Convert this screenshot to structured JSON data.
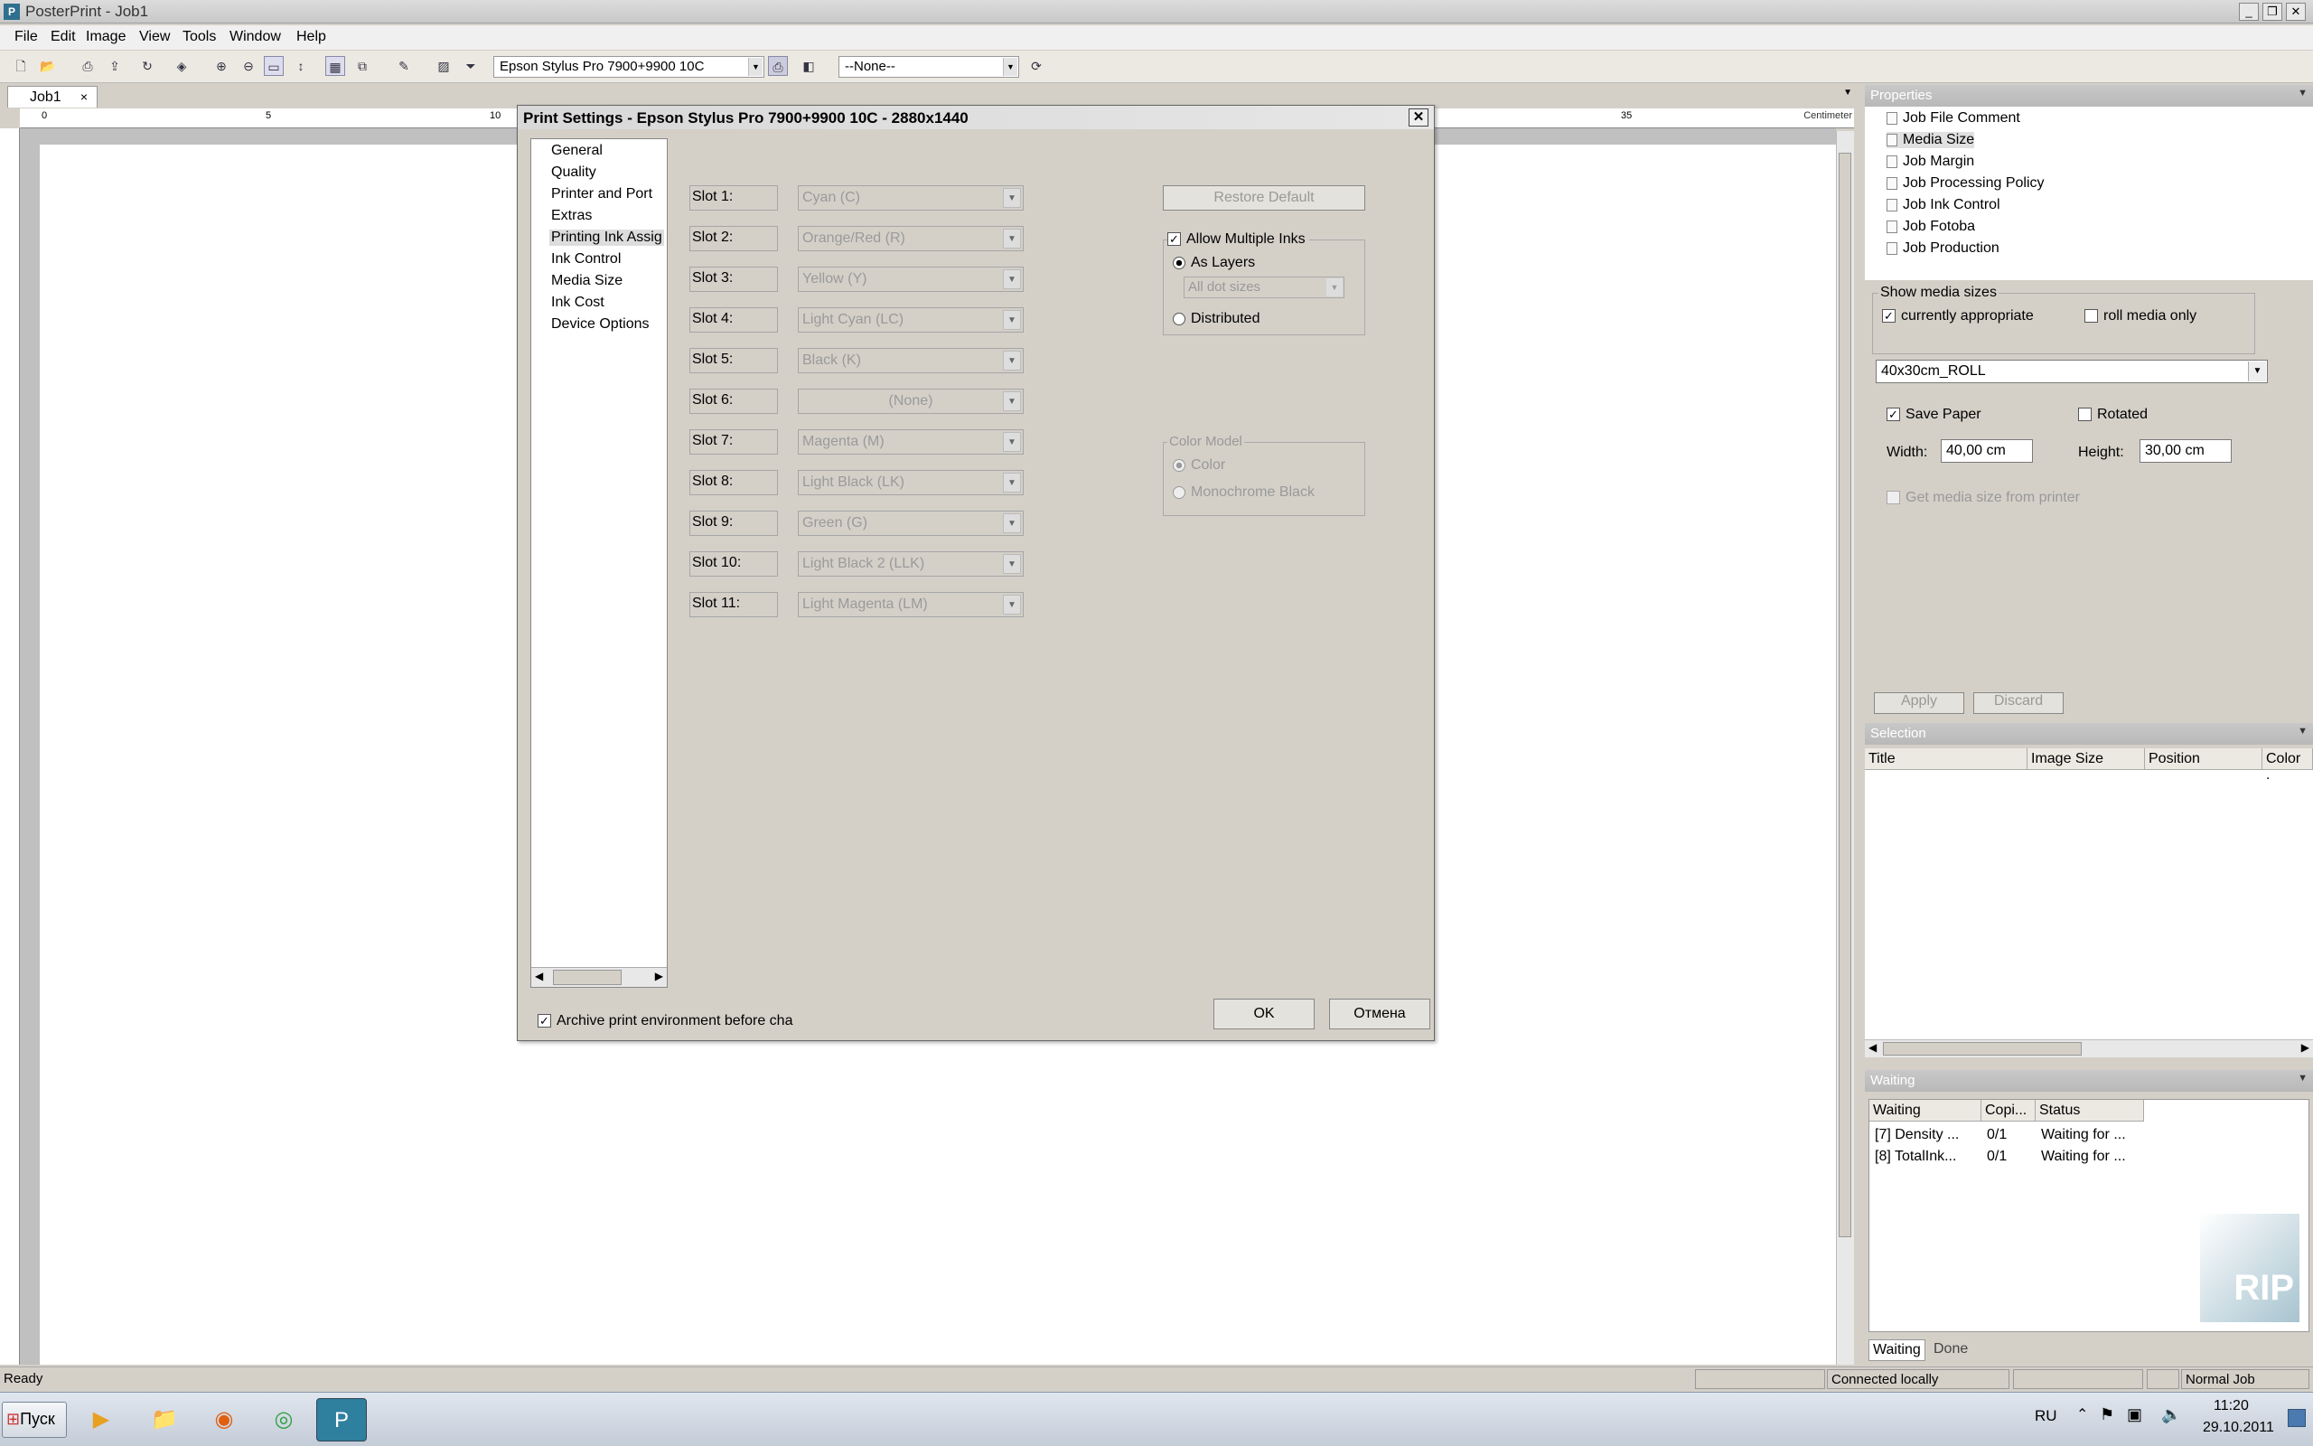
{
  "window": {
    "title": "PosterPrint - Job1"
  },
  "menu": [
    "File",
    "Edit",
    "Image",
    "View",
    "Tools",
    "Window",
    "Help"
  ],
  "toolbar": {
    "printer": "Epson Stylus Pro  7900+9900 10C",
    "profile": "--None--"
  },
  "doc_tab": {
    "label": "Job1",
    "close": "×"
  },
  "ruler": {
    "unit": "Centimeter",
    "marks": [
      "0",
      "5",
      "10",
      "35"
    ]
  },
  "dialog": {
    "title": "Print Settings - Epson Stylus Pro  7900+9900 10C - 2880x1440",
    "nav": [
      "General",
      "Quality",
      "Printer and Port",
      "Extras",
      "Printing Ink Assig",
      "Ink Control",
      "Media Size",
      "Ink Cost",
      "Device Options"
    ],
    "slots": [
      {
        "label": "Slot 1:",
        "value": "Cyan (C)"
      },
      {
        "label": "Slot 2:",
        "value": "Orange/Red (R)"
      },
      {
        "label": "Slot 3:",
        "value": "Yellow (Y)"
      },
      {
        "label": "Slot 4:",
        "value": "Light Cyan (LC)"
      },
      {
        "label": "Slot 5:",
        "value": "Black (K)"
      },
      {
        "label": "Slot 6:",
        "value": "(None)"
      },
      {
        "label": "Slot 7:",
        "value": "Magenta (M)"
      },
      {
        "label": "Slot 8:",
        "value": "Light Black (LK)"
      },
      {
        "label": "Slot 9:",
        "value": "Green (G)"
      },
      {
        "label": "Slot 10:",
        "value": "Light Black 2 (LLK)"
      },
      {
        "label": "Slot 11:",
        "value": "Light Magenta (LM)"
      }
    ],
    "restore_default": "Restore Default",
    "allow_multiple_inks": "Allow Multiple Inks",
    "as_layers": "As Layers",
    "dot_sizes": "All dot sizes",
    "distributed": "Distributed",
    "color_model_title": "Color Model",
    "color": "Color",
    "monochrome": "Monochrome Black",
    "archive": "Archive print environment before cha",
    "ok": "OK",
    "cancel": "Отмена"
  },
  "properties": {
    "title": "Properties",
    "tree": [
      "Job File Comment",
      "Media Size",
      "Job Margin",
      "Job Processing Policy",
      "Job Ink Control",
      "Job Fotoba",
      "Job Production"
    ],
    "show_media_sizes": "Show media sizes",
    "currently_appropriate": "currently appropriate",
    "roll_media_only": "roll media only",
    "media": "40x30cm_ROLL",
    "save_paper": "Save Paper",
    "rotated": "Rotated",
    "width_label": "Width:",
    "width": "40,00 cm",
    "height_label": "Height:",
    "height": "30,00 cm",
    "get_media": "Get media size from printer",
    "apply": "Apply",
    "discard": "Discard"
  },
  "selection": {
    "title": "Selection",
    "columns": [
      "Title",
      "Image Size",
      "Position",
      "Color ."
    ]
  },
  "waiting": {
    "title": "Waiting",
    "columns": [
      "Waiting",
      "Copi...",
      "Status"
    ],
    "rows": [
      {
        "name": "[7]  Density ...",
        "copies": "0/1",
        "status": "Waiting for ..."
      },
      {
        "name": "[8]  TotalInk...",
        "copies": "0/1",
        "status": "Waiting for ..."
      }
    ],
    "tabs": [
      "Waiting",
      "Done"
    ],
    "logo": "RIP"
  },
  "status": {
    "left": "Ready",
    "connection": "Connected locally",
    "job": "Normal Job"
  },
  "taskbar": {
    "start": "Пуск",
    "lang": "RU",
    "time": "11:20",
    "date": "29.10.2011"
  }
}
